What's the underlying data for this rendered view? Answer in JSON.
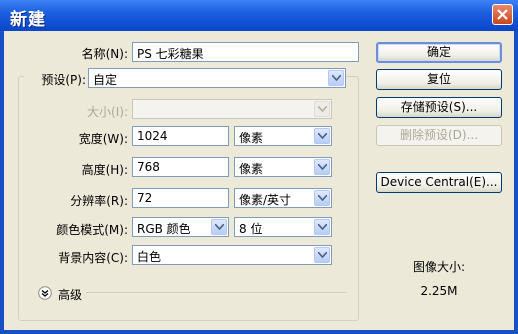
{
  "window": {
    "title": "新建"
  },
  "form": {
    "name_label": "名称(N):",
    "name_value": "PS 七彩糖果",
    "preset_label": "预设(P):",
    "preset_value": "自定",
    "size_label": "大小(I):",
    "size_value": "",
    "width_label": "宽度(W):",
    "width_value": "1024",
    "width_unit": "像素",
    "height_label": "高度(H):",
    "height_value": "768",
    "height_unit": "像素",
    "resolution_label": "分辨率(R):",
    "resolution_value": "72",
    "resolution_unit": "像素/英寸",
    "color_mode_label": "颜色模式(M):",
    "color_mode_value": "RGB 颜色",
    "bit_depth_value": "8 位",
    "background_label": "背景内容(C):",
    "background_value": "白色",
    "advanced_label": "高级"
  },
  "buttons": {
    "ok": "确定",
    "reset": "复位",
    "save_preset": "存储预设(S)...",
    "delete_preset": "删除预设(D)...",
    "device_central": "Device Central(E)..."
  },
  "info": {
    "image_size_label": "图像大小:",
    "image_size_value": "2.25M"
  },
  "colors": {
    "titlebar": "#1d5fe0",
    "dialog_bg": "#ece9d8"
  }
}
